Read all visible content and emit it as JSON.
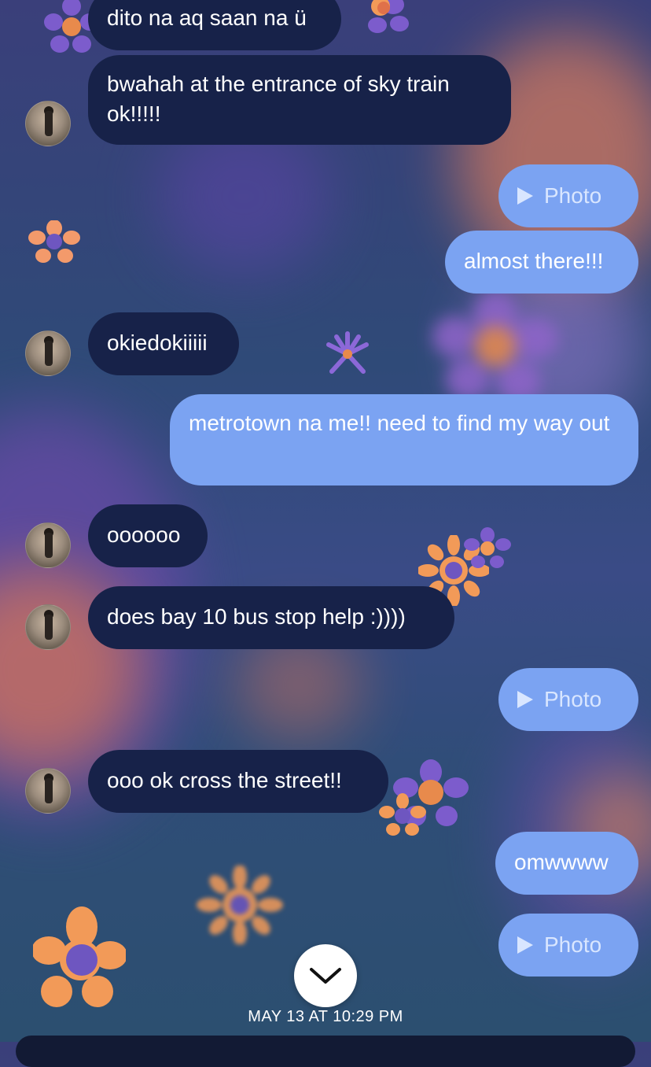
{
  "colors": {
    "incoming_bubble": "#172249",
    "outgoing_bubble": "#7ba3f2",
    "photo_label": "#d9e6ff"
  },
  "messages": [
    {
      "direction": "incoming",
      "text": "dito na aq saan na ü"
    },
    {
      "direction": "incoming",
      "text": "bwahah at the entrance of sky train ok!!!!!"
    },
    {
      "direction": "outgoing",
      "type": "photo",
      "text": "Photo"
    },
    {
      "direction": "outgoing",
      "text": "almost there!!!"
    },
    {
      "direction": "incoming",
      "text": "okiedokiiiii"
    },
    {
      "direction": "outgoing",
      "text": "metrotown na me!! need to find my way out"
    },
    {
      "direction": "incoming",
      "text": "oooooo"
    },
    {
      "direction": "incoming",
      "text": "does bay 10 bus stop help :))))"
    },
    {
      "direction": "outgoing",
      "type": "photo",
      "text": "Photo"
    },
    {
      "direction": "incoming",
      "text": "ooo ok cross the street!!"
    },
    {
      "direction": "outgoing",
      "text": "omwwww"
    },
    {
      "direction": "outgoing",
      "type": "photo",
      "text": "Photo"
    }
  ],
  "timestamp": "MAY 13 AT 10:29 PM",
  "icons": {
    "scroll_down": "chevron-down-icon",
    "play": "play-icon",
    "avatar": "avatar"
  }
}
